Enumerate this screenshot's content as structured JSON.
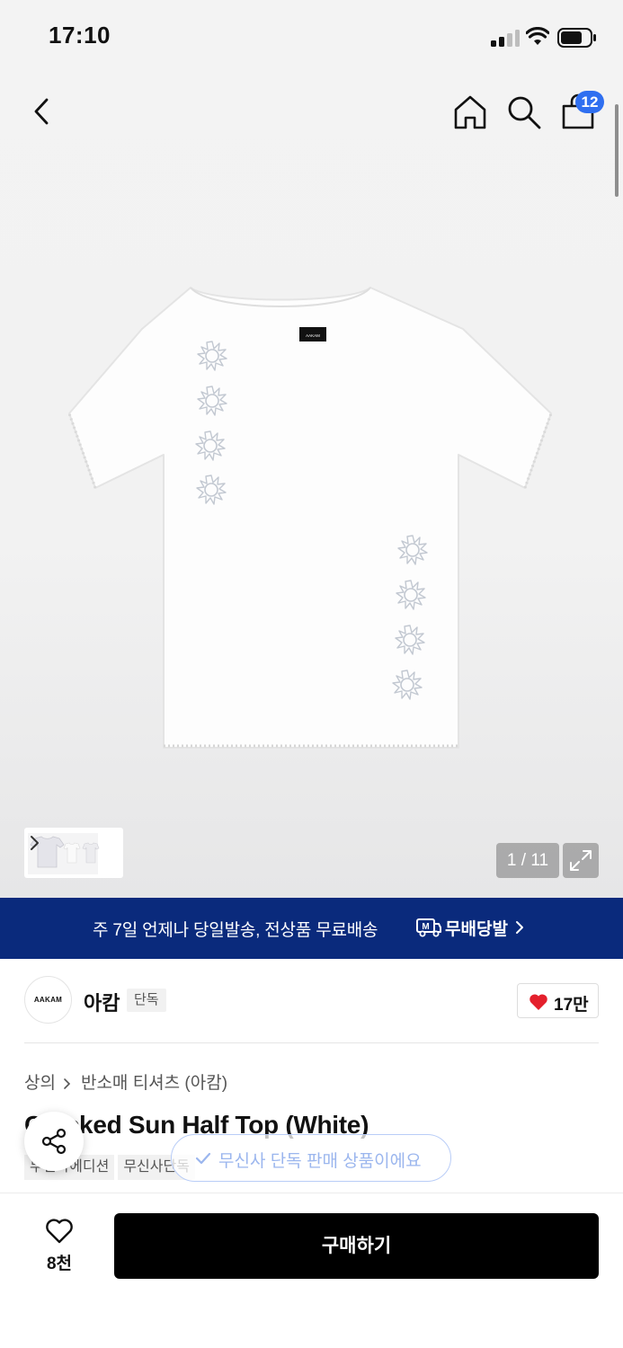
{
  "status_bar": {
    "time": "17:10"
  },
  "header": {
    "cart_count": "12"
  },
  "gallery": {
    "page_counter": "1 / 11"
  },
  "product_image": {
    "tshirt_label": "AAKAM"
  },
  "promo": {
    "text": "주 7일 언제나 당일발송, 전상품 무료배송",
    "brand": "무배당발",
    "logo_letter": "M"
  },
  "brand": {
    "logo_text": "AAKAM",
    "name": "아캄",
    "tag": "단독",
    "like_count": "17만"
  },
  "breadcrumb": {
    "category": "상의",
    "subcategory": "반소매 티셔츠 (아캄)"
  },
  "product": {
    "title": "Cracked Sun Half Top (White)",
    "tags": [
      "무신사에디션",
      "무신사단독"
    ]
  },
  "toast": {
    "text": "무신사 단독 판매 상품이에요"
  },
  "bottom_bar": {
    "wish_count": "8천",
    "buy_label": "구매하기"
  },
  "colors": {
    "promo_bg": "#0a2a7c",
    "badge": "#2f6ff0",
    "heart": "#e4202c",
    "buy_bg": "#000000"
  }
}
